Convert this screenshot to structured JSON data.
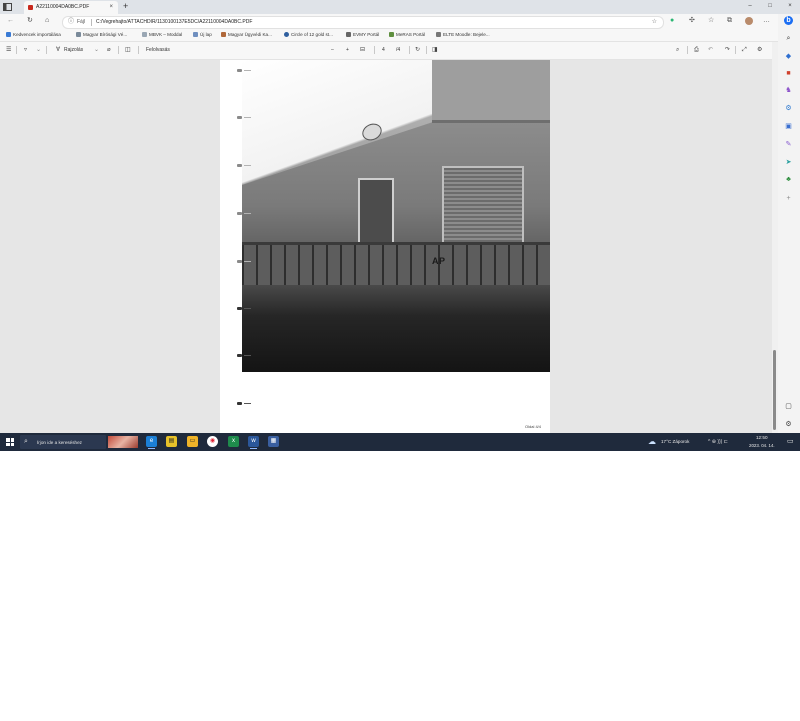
{
  "browser": {
    "tab": {
      "title": "A22110004DA0BC.PDF",
      "close": "×"
    },
    "new_tab": "+",
    "window": {
      "minimize": "–",
      "maximize": "□",
      "close": "×"
    },
    "address": {
      "scheme": "Fájl",
      "url": "C:/Vegrehajto/ATTACHDIR/1130100137E5DC/A22110004DA0BC.PDF"
    },
    "icons": [
      "back-icon",
      "refresh-icon",
      "home-icon",
      "info-icon",
      "star-icon",
      "extension-icon",
      "favorites-icon",
      "collections-icon",
      "profile-icon",
      "more-icon"
    ]
  },
  "favorites": [
    {
      "label": "Kedvencek importálása",
      "color": "#3a7bd5"
    },
    {
      "label": "Magyar Bírósági Vé...",
      "color": "#7a8a9a"
    },
    {
      "label": "MBVK – Moddal",
      "color": "#9aa7b4"
    },
    {
      "label": "Új lap",
      "color": "#6f8fbf"
    },
    {
      "label": "Magyar Ügyvédi Ka...",
      "color": "#b0683a"
    },
    {
      "label": "Circle of 12 gold st...",
      "color": "#2f5f9f"
    },
    {
      "label": "EVMY Portál",
      "color": "#666666"
    },
    {
      "label": "MeRAS Portál",
      "color": "#5f8f3f"
    },
    {
      "label": "ELTE Moodle: Bejele...",
      "color": "#777777"
    }
  ],
  "pdf_toolbar": {
    "read_aloud": "Felolvasás",
    "draw": "Rajzolás",
    "page_current": "4",
    "page_total": "/4",
    "minus": "–",
    "plus": "+"
  },
  "document": {
    "graffiti": "AP",
    "footer": "Oldal 4/4"
  },
  "taskbar": {
    "search_placeholder": "Írjon ide a kereséshez",
    "weather": "17°C Záporok",
    "tray": "^ ⊕ ))) ⊏",
    "time": "12:50",
    "date": "2023. 04. 14."
  },
  "colors": {
    "tab_favicon": "#c8281c",
    "taskbar_bg": "#1f2a3c",
    "viewport_bg": "#e6e6e6"
  }
}
